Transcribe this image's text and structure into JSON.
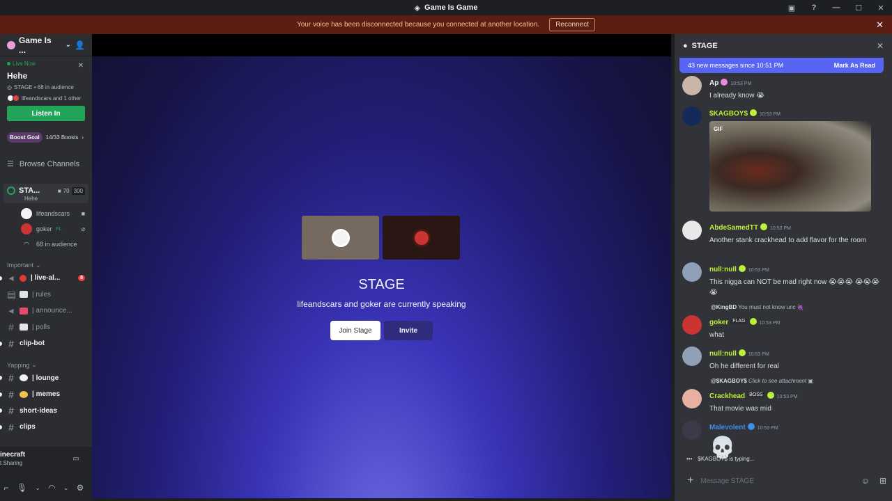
{
  "window": {
    "title": "Game Is Game"
  },
  "banner": {
    "text": "Your voice has been disconnected because you connected at another location.",
    "reconnect": "Reconnect"
  },
  "sidebar": {
    "server_name": "Game Is ...",
    "live_now": "Live Now",
    "live_title": "Hehe",
    "live_meta": "STAGE • 68 in audience",
    "live_speakers": "lifeandscars and 1 other",
    "listen_in": "Listen In",
    "boost_goal": "Boost Goal",
    "boost_progress": "14/33 Boosts",
    "browse": "Browse Channels",
    "stage": {
      "name": "STA...",
      "topic": "Hehe",
      "count": "70",
      "cap": "300"
    },
    "members": [
      {
        "name": "lifeandscars"
      },
      {
        "name": "goker",
        "tag": "FL"
      },
      {
        "name": "68 in audience"
      }
    ],
    "categories": {
      "important": "Important",
      "yapping": "Yapping"
    },
    "important_channels": [
      {
        "name": "| live-al...",
        "unread": true,
        "badge": "8"
      },
      {
        "name": "| rules",
        "unread": false
      },
      {
        "name": "| announce...",
        "unread": false
      },
      {
        "name": "| polls",
        "unread": false
      },
      {
        "name": "clip-bot",
        "unread": true
      }
    ],
    "yapping_channels": [
      {
        "name": "| lounge",
        "unread": true
      },
      {
        "name": "| memes",
        "unread": true
      },
      {
        "name": "short-ideas",
        "unread": true
      },
      {
        "name": "clips",
        "unread": true
      }
    ],
    "voice_panel": {
      "title": "inecraft",
      "sub": "t Sharing"
    }
  },
  "stage": {
    "name": "STAGE",
    "description": "lifeandscars and goker are currently speaking",
    "join": "Join Stage",
    "invite": "Invite"
  },
  "chat": {
    "title": "STAGE",
    "new_messages": "43 new messages since 10:51 PM",
    "mark_read": "Mark As Read",
    "messages": [
      {
        "name": "Ap",
        "time": "10:53 PM",
        "text": "I already know 😭",
        "color": "#f2f3f5"
      },
      {
        "name": "$KAGBOY$",
        "time": "10:53 PM",
        "gif": "GIF",
        "color": "#bdf03a"
      },
      {
        "name": "AbdeSamedTT",
        "time": "10:53 PM",
        "text": "Another stank crackhead to add flavor for the room",
        "color": "#bdf03a"
      },
      {
        "name": "null:null",
        "time": "10:53 PM",
        "text": "This nigga can NOT be mad right now 😭😭😭 😭😭😭😭",
        "color": "#bdf03a"
      },
      {
        "reply_user": "@KingBD",
        "reply_text": "You must not know unc 🍇",
        "name": "goker",
        "tag": "FLAG",
        "time": "10:53 PM",
        "text": "what",
        "color": "#bdf03a"
      },
      {
        "name": "null:null",
        "time": "10:53 PM",
        "text": "Oh he different for real",
        "color": "#bdf03a"
      },
      {
        "reply_user": "@$KAGBOY$",
        "reply_text": "Click to see attachment",
        "name": "Crackhead",
        "tag": "BOSS",
        "time": "10:53 PM",
        "text": "That movie was mid",
        "color": "#bdf03a"
      },
      {
        "name": "Malevolent",
        "time": "10:53 PM",
        "text": "💀",
        "color": "#3b8fe8"
      }
    ],
    "typing": "$KAGBOY$ is typing...",
    "composer_placeholder": "Message STAGE"
  }
}
